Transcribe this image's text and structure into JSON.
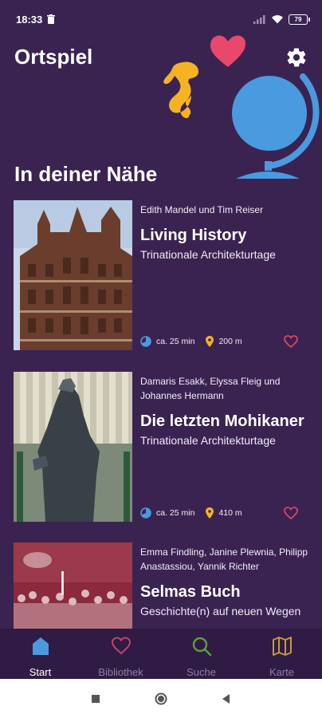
{
  "status_bar": {
    "time": "18:33",
    "battery": "79",
    "icons": [
      "trash-icon",
      "signal-icon",
      "wifi-icon",
      "battery-icon"
    ]
  },
  "header": {
    "title": "Ortspiel",
    "settings_icon": "gear-icon"
  },
  "section": {
    "title": "In deiner Nähe"
  },
  "cards": [
    {
      "authors": "Edith Mandel und Tim Reiser",
      "title": "Living History",
      "subtitle": "Trinationale Architekturtage",
      "duration": "ca. 25 min",
      "distance": "200 m"
    },
    {
      "authors": "Damaris Esakk, Elyssa Fleig und Johannes Hermann",
      "title": "Die letzten Mohikaner",
      "subtitle": "Trinationale Architekturtage",
      "duration": "ca. 25 min",
      "distance": "410 m"
    },
    {
      "authors": "Emma Findling, Janine Plewnia, Philipp Anastassiou, Yannik Richter",
      "title": "Selmas Buch",
      "subtitle": "Geschichte(n) auf neuen Wegen"
    }
  ],
  "nav": {
    "items": [
      {
        "label": "Start",
        "icon": "home-icon"
      },
      {
        "label": "Bibliothek",
        "icon": "heart-icon"
      },
      {
        "label": "Suche",
        "icon": "search-icon"
      },
      {
        "label": "Karte",
        "icon": "map-icon"
      }
    ],
    "active": "Start"
  },
  "colors": {
    "background": "#3a2351",
    "nav_background": "#2f1b44",
    "accent_blue": "#4a9ae0",
    "heart_pink": "#e8486b",
    "seahorse_yellow": "#f5b324",
    "search_green": "#5e9d3f",
    "map_gold": "#c79a3a"
  }
}
